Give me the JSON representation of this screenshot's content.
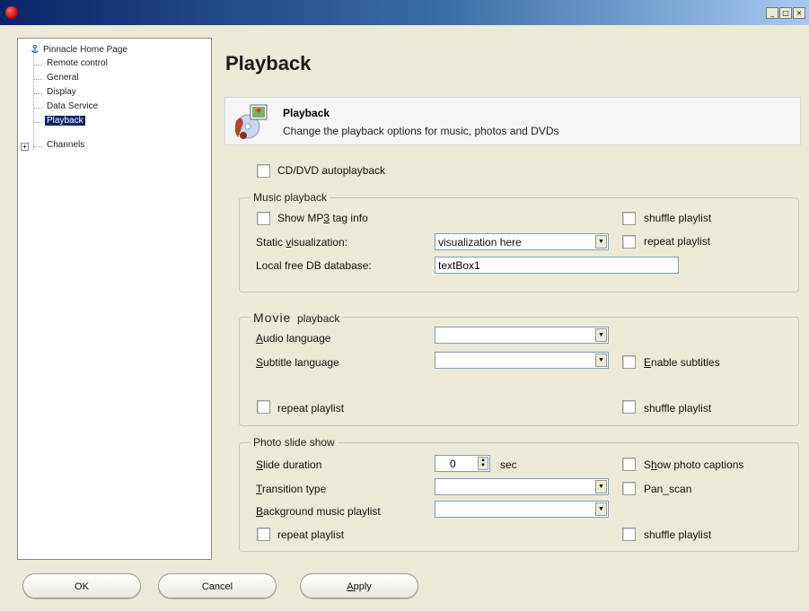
{
  "window": {
    "min_glyph": "_",
    "max_glyph": "□",
    "close_glyph": "×"
  },
  "tree": {
    "items": [
      {
        "label": "Pinnacle Home Page",
        "icon": "home-icon"
      },
      {
        "label": "Remote control"
      },
      {
        "label": "General"
      },
      {
        "label": "Display"
      },
      {
        "label": "Data Service"
      },
      {
        "label": "Playback",
        "selected": true
      },
      {
        "label": "Channels",
        "expander": "+"
      }
    ]
  },
  "page": {
    "title": "Playback",
    "header_title": "Playback",
    "header_desc": "Change the playback options for music, photos and DVDs",
    "header_icon": "playback-media-icon",
    "cd_autoplay": "CD/DVD autoplayback"
  },
  "music": {
    "legend": "Music playback",
    "show_mp3": {
      "pre": "Show MP",
      "mn": "3",
      "post": " tag info"
    },
    "shuffle": "shuffle playlist",
    "repeat": "repeat playlist",
    "static_vis": {
      "pre": "Static ",
      "mn": "v",
      "post": "isualization:"
    },
    "vis_value": "visualization here",
    "local_db": "Local free DB database:",
    "textbox_value": "textBox1"
  },
  "movie": {
    "legend_a": "Movie",
    "legend_b": "playback",
    "audio": {
      "mn": "A",
      "post": "udio language"
    },
    "subtitle": {
      "mn": "S",
      "post": "ubtitle language"
    },
    "enable_subtitles": {
      "mn": "E",
      "post": "nable subtitles"
    },
    "repeat": "repeat playlist",
    "shuffle": "shuffle playlist"
  },
  "photo": {
    "legend": "Photo slide show",
    "duration": {
      "mn": "S",
      "post": "lide duration"
    },
    "duration_value": "0",
    "sec": "sec",
    "captions": {
      "pre": "S",
      "mn": "h",
      "post": "ow photo captions"
    },
    "transition": {
      "mn": "T",
      "post": "ransition type"
    },
    "pan_scan": "Pan_scan",
    "bg_music": {
      "mn": "B",
      "post": "ackground music playlist"
    },
    "repeat": "repeat playlist",
    "shuffle": "shuffle playlist"
  },
  "buttons": {
    "ok": "OK",
    "cancel": "Cancel",
    "apply": {
      "mn": "A",
      "post": "pply"
    }
  }
}
